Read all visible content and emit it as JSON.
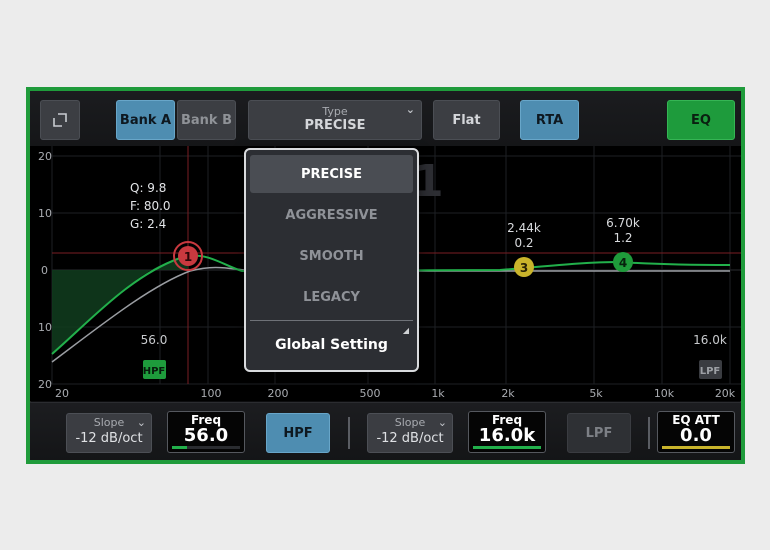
{
  "topbar": {
    "bank_a": "Bank A",
    "bank_b": "Bank B",
    "type_label": "Type",
    "type_value": "PRECISE",
    "flat": "Flat",
    "rta": "RTA",
    "eq": "EQ"
  },
  "graph": {
    "y_ticks": [
      "20",
      "10",
      "0",
      "10",
      "20"
    ],
    "x_ticks": [
      "20",
      "100",
      "200",
      "500",
      "1k",
      "2k",
      "5k",
      "10k",
      "20k"
    ],
    "band1": {
      "num": "1",
      "q_label": "Q: 9.8",
      "f_label": "F: 80.0",
      "g_label": "G: 2.4"
    },
    "band3": {
      "num": "3",
      "freq": "2.44k",
      "q": "0.2"
    },
    "band4": {
      "num": "4",
      "freq": "6.70k",
      "q": "1.2"
    },
    "hpf_freq": "56.0",
    "hpf_tag": "HPF",
    "lpf_freq": "16.0k",
    "lpf_tag": "LPF",
    "bg_number": "1"
  },
  "dropdown": {
    "items": [
      "PRECISE",
      "AGGRESSIVE",
      "SMOOTH",
      "LEGACY"
    ],
    "selected": "PRECISE",
    "global": "Global Setting"
  },
  "bottombar": {
    "hpf_slope_label": "Slope",
    "hpf_slope_value": "-12 dB/oct",
    "hpf_freq_label": "Freq",
    "hpf_freq_value": "56.0",
    "hpf_button": "HPF",
    "lpf_slope_label": "Slope",
    "lpf_slope_value": "-12 dB/oct",
    "lpf_freq_label": "Freq",
    "lpf_freq_value": "16.0k",
    "lpf_button": "LPF",
    "eq_att_label": "EQ ATT",
    "eq_att_value": "0.0"
  },
  "colors": {
    "frame_green": "#1f9b3b",
    "band1": "#c8393f",
    "band3": "#c9b42b",
    "band4": "#1f9b3b",
    "curve": "#22b04b",
    "accent_blue": "#4e8db1"
  },
  "icons": {
    "expand": "expand-corner-icon",
    "chevron": "chevron-down-icon",
    "external": "external-link-icon"
  }
}
